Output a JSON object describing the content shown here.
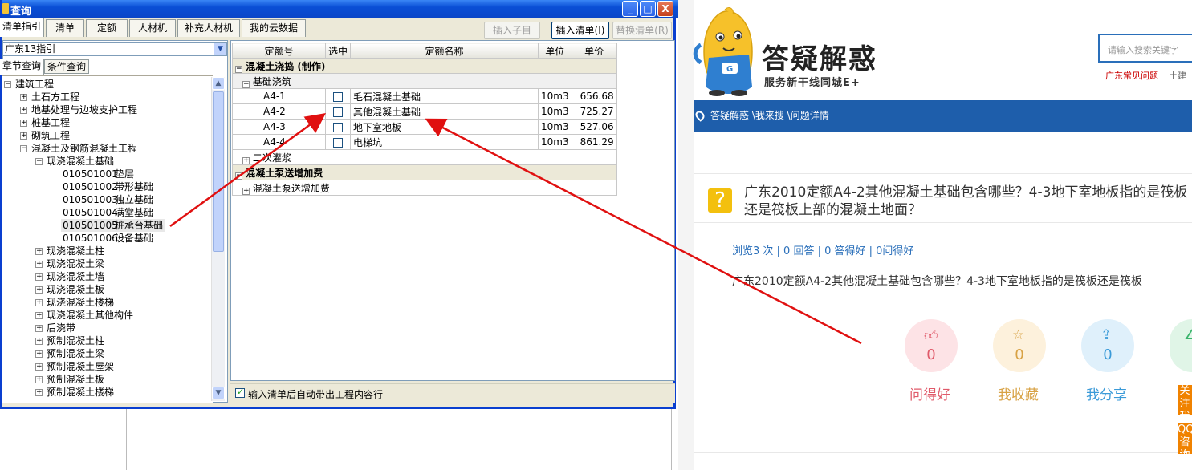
{
  "window": {
    "title": "查询",
    "buttons": {
      "minimize": "_",
      "maximize": "□",
      "close": "X"
    }
  },
  "tabs": [
    "清单指引",
    "清单",
    "定额",
    "人材机",
    "补充人材机",
    "我的云数据"
  ],
  "toolbar": {
    "insert_child": "插入子目",
    "insert_list": "插入清单(I)",
    "replace_list": "替换清单(R)"
  },
  "combo": {
    "value": "广东13指引"
  },
  "subtabs": [
    "章节查询",
    "条件查询"
  ],
  "tree": [
    {
      "text": "建筑工程",
      "pm": "−"
    },
    {
      "text": "土石方工程",
      "pm": "+"
    },
    {
      "text": "地基处理与边坡支护工程",
      "pm": "+"
    },
    {
      "text": "桩基工程",
      "pm": "+"
    },
    {
      "text": "砌筑工程",
      "pm": "+"
    },
    {
      "text": "混凝土及钢筋混凝土工程",
      "pm": "−"
    },
    {
      "text": "现浇混凝土基础",
      "pm": "−"
    },
    {
      "code": "010501001",
      "text": "垫层"
    },
    {
      "code": "010501002",
      "text": "带形基础"
    },
    {
      "code": "010501003",
      "text": "独立基础"
    },
    {
      "code": "010501004",
      "text": "满堂基础"
    },
    {
      "code": "010501005",
      "text": "桩承台基础"
    },
    {
      "code": "010501006",
      "text": "设备基础"
    },
    {
      "text": "现浇混凝土柱",
      "pm": "+"
    },
    {
      "text": "现浇混凝土梁",
      "pm": "+"
    },
    {
      "text": "现浇混凝土墙",
      "pm": "+"
    },
    {
      "text": "现浇混凝土板",
      "pm": "+"
    },
    {
      "text": "现浇混凝土楼梯",
      "pm": "+"
    },
    {
      "text": "现浇混凝土其他构件",
      "pm": "+"
    },
    {
      "text": "后浇带",
      "pm": "+"
    },
    {
      "text": "预制混凝土柱",
      "pm": "+"
    },
    {
      "text": "预制混凝土梁",
      "pm": "+"
    },
    {
      "text": "预制混凝土屋架",
      "pm": "+"
    },
    {
      "text": "预制混凝土板",
      "pm": "+"
    },
    {
      "text": "预制混凝土楼梯",
      "pm": "+"
    }
  ],
  "grid": {
    "headers": [
      "定额号",
      "选中",
      "定额名称",
      "单位",
      "单价"
    ],
    "group1": "混凝土浇捣 (制作)",
    "sub1": "基础浇筑",
    "rows": [
      {
        "code": "A4-1",
        "name": "毛石混凝土基础",
        "unit": "10m3",
        "price": "656.68"
      },
      {
        "code": "A4-2",
        "name": "其他混凝土基础",
        "unit": "10m3",
        "price": "725.27"
      },
      {
        "code": "A4-3",
        "name": "地下室地板",
        "unit": "10m3",
        "price": "527.06"
      },
      {
        "code": "A4-4",
        "name": "电梯坑",
        "unit": "10m3",
        "price": "861.29"
      }
    ],
    "sub2": "二次灌浆",
    "group2": "混凝土泵送增加费",
    "sub3": "混凝土泵送增加费"
  },
  "status": {
    "auto_label": "输入清单后自动带出工程内容行"
  },
  "site": {
    "brand": "答疑解惑",
    "slogan": "服务新干线同城E+",
    "search_placeholder": "请输入搜索关键字",
    "hotlinks": [
      "广东常见问题",
      "土建"
    ],
    "breadcrumb": "答疑解惑 \\我来搜 \\问题详情",
    "question_title": "广东2010定额A4-2其他混凝土基础包含哪些？4-3地下室地板指的是筏板还是筏板上部的混凝土地面？",
    "stats": "浏览3 次 | 0 回答 | 0 答得好 | 0问得好",
    "question_body": "广东2010定额A4-2其他混凝土基础包含哪些？4-3地下室地板指的是筏板还是筏板",
    "actions": [
      {
        "label": "问得好",
        "count": "0",
        "color": "#e05a6a",
        "bg": "#fde3e6"
      },
      {
        "label": "我收藏",
        "count": "0",
        "color": "#d8a244",
        "bg": "#fdf1dc"
      },
      {
        "label": "我分享",
        "count": "0",
        "color": "#3a9ad8",
        "bg": "#dff0fb"
      },
      {
        "label": "",
        "count": "",
        "color": "#3ab46c",
        "bg": "#e0f5e7"
      }
    ],
    "side_tabs": [
      "关注我",
      "QQ咨询"
    ]
  },
  "colors": {
    "accent": "#1e5eab",
    "arrow": "#e01010"
  }
}
